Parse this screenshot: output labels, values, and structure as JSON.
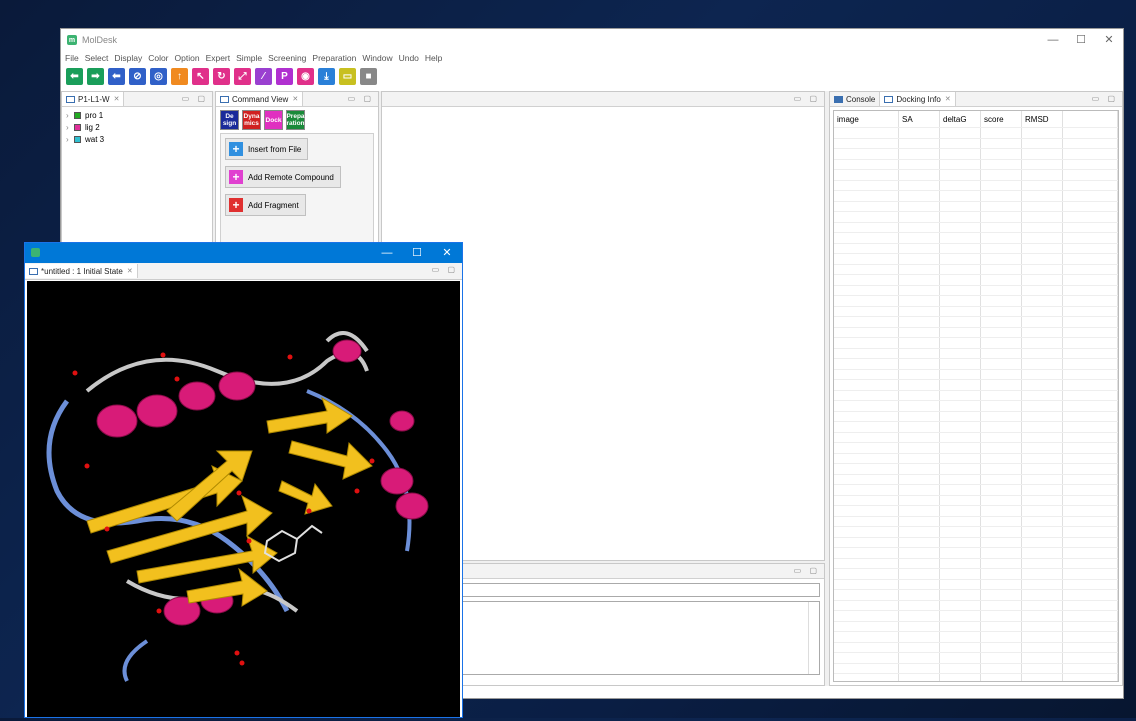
{
  "app": {
    "title": "MolDesk"
  },
  "window_controls": {
    "minimize": "—",
    "maximize": "☐",
    "close": "✕"
  },
  "menu": [
    "File",
    "Select",
    "Display",
    "Color",
    "Option",
    "Expert",
    "Simple",
    "Screening",
    "Preparation",
    "Window",
    "Undo",
    "Help"
  ],
  "toolbar": [
    {
      "icon": "arrow-left-icon",
      "color": "#1a9e5a",
      "glyph": "⬅"
    },
    {
      "icon": "arrow-right-icon",
      "color": "#1a9e5a",
      "glyph": "➡"
    },
    {
      "icon": "back-icon",
      "color": "#3060c8",
      "glyph": "⬅"
    },
    {
      "icon": "no-entry-icon",
      "color": "#3060c8",
      "glyph": "⊘"
    },
    {
      "icon": "target-icon",
      "color": "#3060c8",
      "glyph": "◎"
    },
    {
      "icon": "arrow-up-icon",
      "color": "#f08a20",
      "glyph": "↑"
    },
    {
      "icon": "select-arrow-icon",
      "color": "#e0308a",
      "glyph": "↖"
    },
    {
      "icon": "rotate-icon",
      "color": "#e0308a",
      "glyph": "↻"
    },
    {
      "icon": "expand-icon",
      "color": "#e0308a",
      "glyph": "⤢"
    },
    {
      "icon": "slash-icon",
      "color": "#9a40d0",
      "glyph": "⁄"
    },
    {
      "icon": "p-icon",
      "color": "#b030d0",
      "glyph": "P"
    },
    {
      "icon": "eye-icon",
      "color": "#e0308a",
      "glyph": "◉"
    },
    {
      "icon": "download-icon",
      "color": "#2a80d8",
      "glyph": "⤓"
    },
    {
      "icon": "monitor-icon",
      "color": "#c8c020",
      "glyph": "▭"
    },
    {
      "icon": "stop-icon",
      "color": "#888888",
      "glyph": "■"
    }
  ],
  "project_pane": {
    "tab": "P1-L1-W",
    "items": [
      {
        "label": "pro 1",
        "color": "#22aa22"
      },
      {
        "label": "lig 2",
        "color": "#e0309a"
      },
      {
        "label": "wat 3",
        "color": "#30c0d0"
      }
    ]
  },
  "command_view": {
    "tab": "Command View",
    "tabs": [
      {
        "label": "De\nsign",
        "color": "#1a2a9a"
      },
      {
        "label": "Dyna\nmics",
        "color": "#d02020"
      },
      {
        "label": "Dock",
        "color": "#e030c0"
      },
      {
        "label": "Prepa\nration",
        "color": "#1a8a3a"
      }
    ],
    "buttons": [
      {
        "label": "Insert from File",
        "color": "#3090e0"
      },
      {
        "label": "Add Remote Compound",
        "color": "#e040d0"
      },
      {
        "label": "Add Fragment",
        "color": "#e03030"
      }
    ]
  },
  "right_pane": {
    "tabs": [
      {
        "label": "Console"
      },
      {
        "label": "Docking Info"
      }
    ],
    "columns": [
      "image",
      "SA",
      "deltaG",
      "score",
      "RMSD"
    ]
  },
  "viewer": {
    "tab": "*untitled : 1 Initial State"
  }
}
